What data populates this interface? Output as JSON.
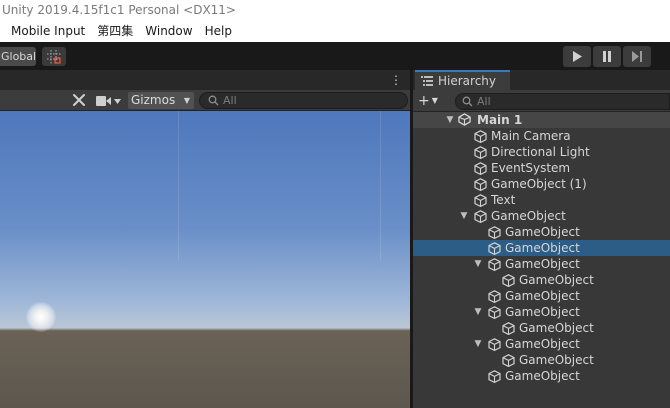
{
  "window": {
    "title": "Unity 2019.4.15f1c1 Personal <DX11>"
  },
  "menu": {
    "items": [
      "Mobile Input",
      "第四集",
      "Window",
      "Help"
    ]
  },
  "toolbar": {
    "global_label": "Global"
  },
  "scene": {
    "gizmos_label": "Gizmos",
    "search_placeholder": "All"
  },
  "hierarchy": {
    "tab_label": "Hierarchy",
    "search_placeholder": "All",
    "scene_name": "Main 1",
    "items": [
      {
        "label": "Main Camera",
        "depth": 1,
        "expanded": null,
        "selected": false
      },
      {
        "label": "Directional Light",
        "depth": 1,
        "expanded": null,
        "selected": false
      },
      {
        "label": "EventSystem",
        "depth": 1,
        "expanded": null,
        "selected": false
      },
      {
        "label": "GameObject (1)",
        "depth": 1,
        "expanded": null,
        "selected": false
      },
      {
        "label": "Text",
        "depth": 1,
        "expanded": null,
        "selected": false
      },
      {
        "label": "GameObject",
        "depth": 1,
        "expanded": true,
        "selected": false
      },
      {
        "label": "GameObject",
        "depth": 2,
        "expanded": null,
        "selected": false
      },
      {
        "label": "GameObject",
        "depth": 2,
        "expanded": null,
        "selected": true
      },
      {
        "label": "GameObject",
        "depth": 2,
        "expanded": true,
        "selected": false
      },
      {
        "label": "GameObject",
        "depth": 3,
        "expanded": null,
        "selected": false
      },
      {
        "label": "GameObject",
        "depth": 2,
        "expanded": null,
        "selected": false
      },
      {
        "label": "GameObject",
        "depth": 2,
        "expanded": true,
        "selected": false
      },
      {
        "label": "GameObject",
        "depth": 3,
        "expanded": null,
        "selected": false
      },
      {
        "label": "GameObject",
        "depth": 2,
        "expanded": true,
        "selected": false
      },
      {
        "label": "GameObject",
        "depth": 3,
        "expanded": null,
        "selected": false
      },
      {
        "label": "GameObject",
        "depth": 2,
        "expanded": null,
        "selected": false
      }
    ]
  },
  "colors": {
    "selection": "#2c5d87",
    "tab_accent": "#3a79bb",
    "sky": "#6a8fc8",
    "ground": "#5d574d"
  }
}
